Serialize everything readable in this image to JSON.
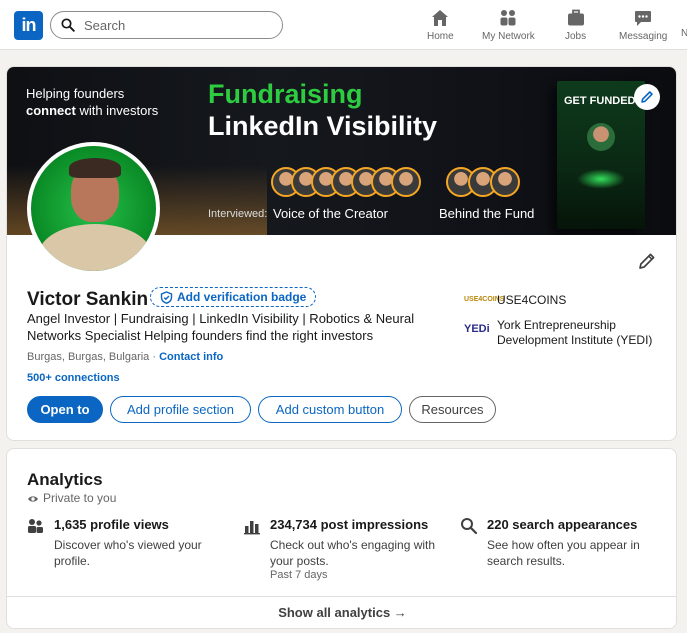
{
  "nav": {
    "logo_text": "in",
    "search_placeholder": "Search",
    "items": [
      {
        "label": "Home",
        "icon": "home-icon"
      },
      {
        "label": "My Network",
        "icon": "network-icon"
      },
      {
        "label": "Jobs",
        "icon": "briefcase-icon"
      },
      {
        "label": "Messaging",
        "icon": "messaging-icon"
      },
      {
        "label": "N"
      }
    ]
  },
  "banner": {
    "tagline_line1": "Helping founders",
    "tagline_connect": "connect",
    "tagline_rest": " with investors",
    "title_line1": "Fundraising",
    "title_line2": "LinkedIn Visibility",
    "interviewed_label": "Interviewed:",
    "show1": "Voice of the Creator",
    "show2": "Behind the Fund",
    "book_title": "GET FUNDED"
  },
  "profile": {
    "name": "Victor Sankin",
    "verify_badge": "Add verification badge",
    "headline": "Angel Investor | Fundraising | LinkedIn Visibility | Robotics & Neural Networks Specialist Helping founders find the right investors",
    "location": "Burgas, Burgas, Bulgaria · ",
    "contact_info": "Contact info",
    "connections": "500+ connections",
    "buttons": {
      "open_to": "Open to",
      "add_section": "Add profile section",
      "add_custom": "Add custom button",
      "resources": "Resources"
    },
    "orgs": [
      {
        "logo": "USE4COINS",
        "name_line1": "USE4COINS",
        "name_line2": ""
      },
      {
        "logo": "YEDi",
        "name_line1": "York Entrepreneurship",
        "name_line2": "Development Institute (YEDI)"
      }
    ]
  },
  "analytics": {
    "title": "Analytics",
    "private": "Private to you",
    "items": [
      {
        "stat": "1,635 profile views",
        "desc_line1": "Discover who's viewed your",
        "desc_line2": "profile.",
        "note": ""
      },
      {
        "stat": "234,734 post impressions",
        "desc_line1": "Check out who's engaging with",
        "desc_line2": "your posts.",
        "note": "Past 7 days"
      },
      {
        "stat": "220 search appearances",
        "desc_line1": "See how often you appear in",
        "desc_line2": "search results.",
        "note": ""
      }
    ],
    "footer": "Show all analytics →"
  },
  "colors": {
    "brand_blue": "#0a66c2",
    "banner_green": "#2ecc40",
    "page_bg": "#f4f2ee"
  }
}
